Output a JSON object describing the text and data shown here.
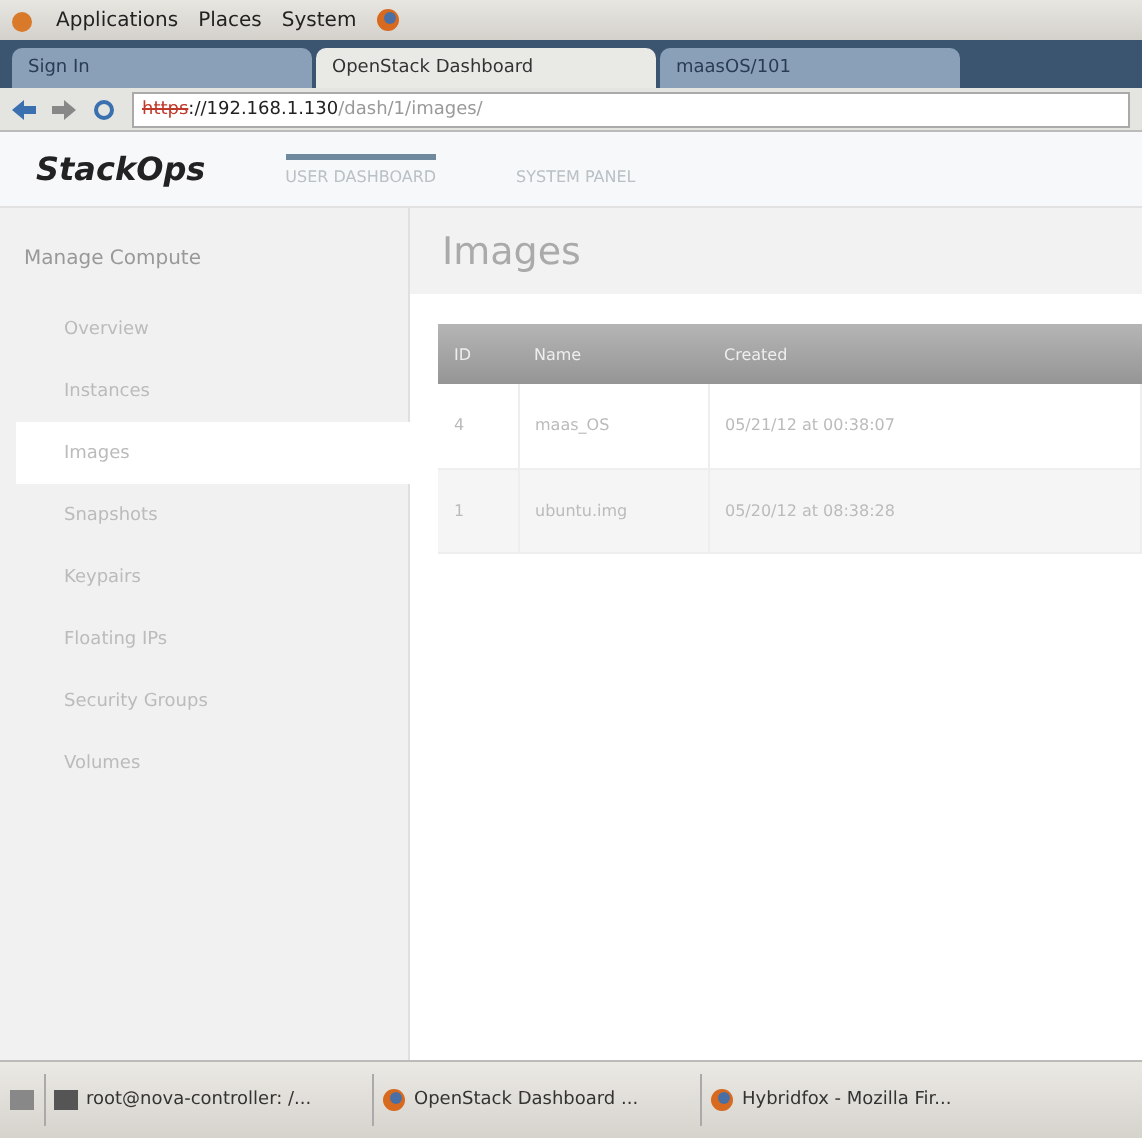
{
  "top_panel": {
    "menus": [
      "Applications",
      "Places",
      "System"
    ]
  },
  "browser_tabs": [
    {
      "label": "Sign In",
      "selected": false
    },
    {
      "label": "OpenStack Dashboard",
      "selected": true
    },
    {
      "label": "maasOS/101",
      "selected": false
    }
  ],
  "address_bar": {
    "scheme": "https",
    "host": "://192.168.1.130",
    "path": "/dash/1/images/"
  },
  "header": {
    "logo": "StackOps",
    "nav": [
      {
        "label": "USER DASHBOARD",
        "selected": true
      },
      {
        "label": "SYSTEM PANEL",
        "selected": false
      }
    ]
  },
  "sidebar": {
    "heading": "Manage Compute",
    "items": [
      {
        "label": "Overview",
        "selected": false
      },
      {
        "label": "Instances",
        "selected": false
      },
      {
        "label": "Images",
        "selected": true
      },
      {
        "label": "Snapshots",
        "selected": false
      },
      {
        "label": "Keypairs",
        "selected": false
      },
      {
        "label": "Floating IPs",
        "selected": false
      },
      {
        "label": "Security Groups",
        "selected": false
      },
      {
        "label": "Volumes",
        "selected": false
      }
    ]
  },
  "page_title": "Images",
  "table": {
    "columns": [
      "ID",
      "Name",
      "Created"
    ],
    "rows": [
      [
        "4",
        "maas_OS",
        "05/21/12 at 00:38:07"
      ],
      [
        "1",
        "ubuntu.img",
        "05/20/12 at 08:38:28"
      ]
    ]
  },
  "taskbar": [
    "root@nova-controller: /...",
    "OpenStack Dashboard ...",
    "Hybridfox - Mozilla Fir..."
  ]
}
